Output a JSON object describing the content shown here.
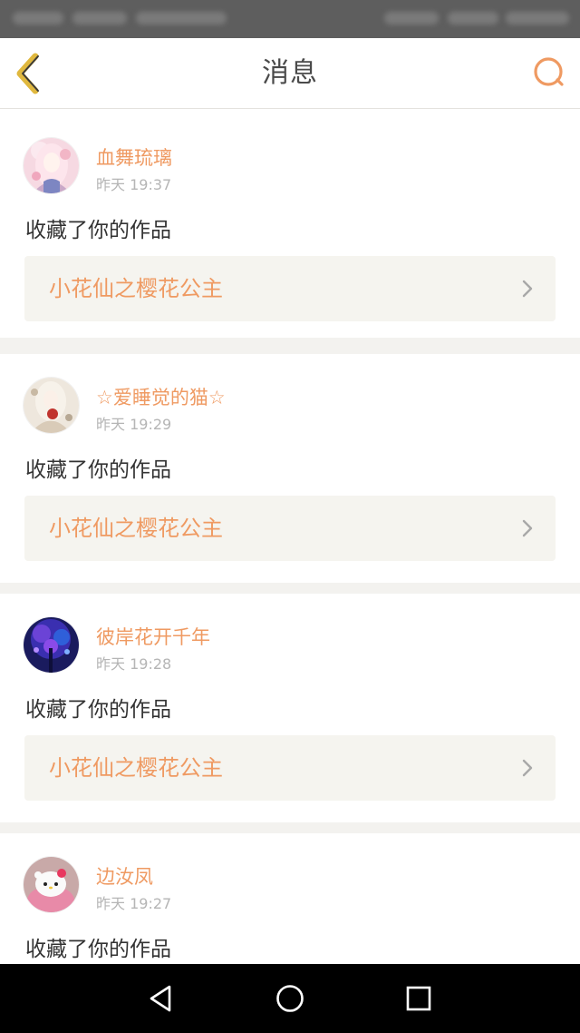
{
  "header": {
    "title": "消息",
    "back_icon": "chevron-left-icon",
    "search_icon": "search-icon"
  },
  "colors": {
    "accent": "#ef9a62",
    "back_icon": "#e0b83e",
    "card_link_bg": "#f5f4ef",
    "page_bg": "#f3f2ef"
  },
  "messages": [
    {
      "username": "血舞琉璃",
      "time": "昨天 19:37",
      "action": "收藏了你的作品",
      "work_title": "小花仙之樱花公主"
    },
    {
      "username": "☆爱睡觉的猫☆",
      "time": "昨天 19:29",
      "action": "收藏了你的作品",
      "work_title": "小花仙之樱花公主"
    },
    {
      "username": "彼岸花开千年",
      "time": "昨天 19:28",
      "action": "收藏了你的作品",
      "work_title": "小花仙之樱花公主"
    },
    {
      "username": "边汝凤",
      "time": "昨天 19:27",
      "action": "收藏了你的作品"
    }
  ],
  "navbar": {
    "icons": [
      "back-triangle-icon",
      "home-circle-icon",
      "recents-square-icon"
    ]
  }
}
